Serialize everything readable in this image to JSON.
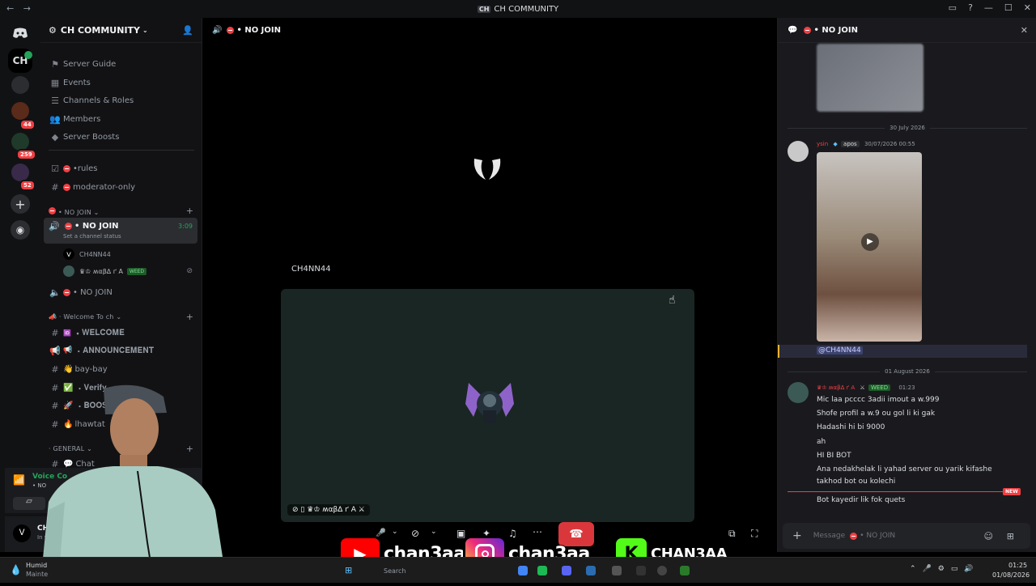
{
  "window": {
    "title": "CH COMMUNITY",
    "tag": "CH"
  },
  "servers": {
    "ch_label": "CH",
    "badges": [
      "44",
      "259",
      "52"
    ]
  },
  "sidebar": {
    "guild_name": "CH COMMUNITY",
    "top_items": [
      "Server Guide",
      "Events",
      "Channels & Roles",
      "Members",
      "Server Boosts"
    ],
    "channels_top": [
      "•rules",
      "moderator-only"
    ],
    "category_nojoin": "• NO JOIN",
    "active_channel": {
      "name": "• NO JOIN",
      "timer": "3:09",
      "status": "Set a channel status"
    },
    "voice_users": [
      {
        "name": "CH4NN44"
      },
      {
        "name": "♛♔ ʍαβ∆ ґ A",
        "badge": "WEED"
      }
    ],
    "channel_nojoin2": "• NO JOIN",
    "category_welcome": "Welcome To ch",
    "welcome_channels": [
      "𝐖𝐄𝐋𝐂𝐎𝐌𝐄",
      "𝐀𝐍𝐍𝐎𝐔𝐍𝐂𝐄𝐌𝐄𝐍𝐓",
      "bay-bay",
      "𝐕𝐞𝐫𝐢𝐟𝐲",
      "𝐁𝐎𝐎𝐒𝐓",
      "lhawtat"
    ],
    "category_general": "GENERAL",
    "general_channels": [
      "Chat"
    ],
    "voice_connected": "Voice Co",
    "voice_sub": "• NO",
    "user_name": "CH4",
    "user_status": "In v"
  },
  "main": {
    "channel_title": "• NO JOIN",
    "speaker_label": "CH4NN44",
    "tile_nameplate": "♛♔ ʍαβ∆ ґ A"
  },
  "chat": {
    "header": "• NO JOIN",
    "date1": "30 July 2026",
    "msg1": {
      "author": "ysin",
      "role_tag": "apos",
      "timestamp": "30/07/2026 00:55"
    },
    "mention": "@CH4NN44",
    "date2": "01 August 2026",
    "msg2": {
      "author": "♛♔ ʍαβ∆ ґ A",
      "badge": "WEED",
      "timestamp": "01:23",
      "lines": [
        "Mic laa pcccc 3adii imout a w.999",
        "Shofe profil a w.9 ou gol li ki gak",
        "Hadashi hi bi 9000",
        "ah",
        "HI BI BOT",
        "Ana nedakhelak li yahad server ou yarik kifashe",
        "takhod bot ou kolechi"
      ]
    },
    "new_label": "NEW",
    "last_line": "Bot kayedir lik fok quets",
    "input_placeholder_prefix": "Message",
    "input_placeholder_channel": "• NO JOIN"
  },
  "overlay": {
    "youtube": "chan3aa",
    "instagram": "chan3aa_",
    "kick": "CHAN3AA"
  },
  "taskbar": {
    "weather_title": "Humid",
    "weather_sub": "Mainte",
    "search": "Search",
    "time": "01:25",
    "date": "01/08/2026"
  },
  "colors": {
    "accent": "#5865f2",
    "danger": "#da373c",
    "mention_bg": "#3a3a5a",
    "online": "#23a55a"
  }
}
